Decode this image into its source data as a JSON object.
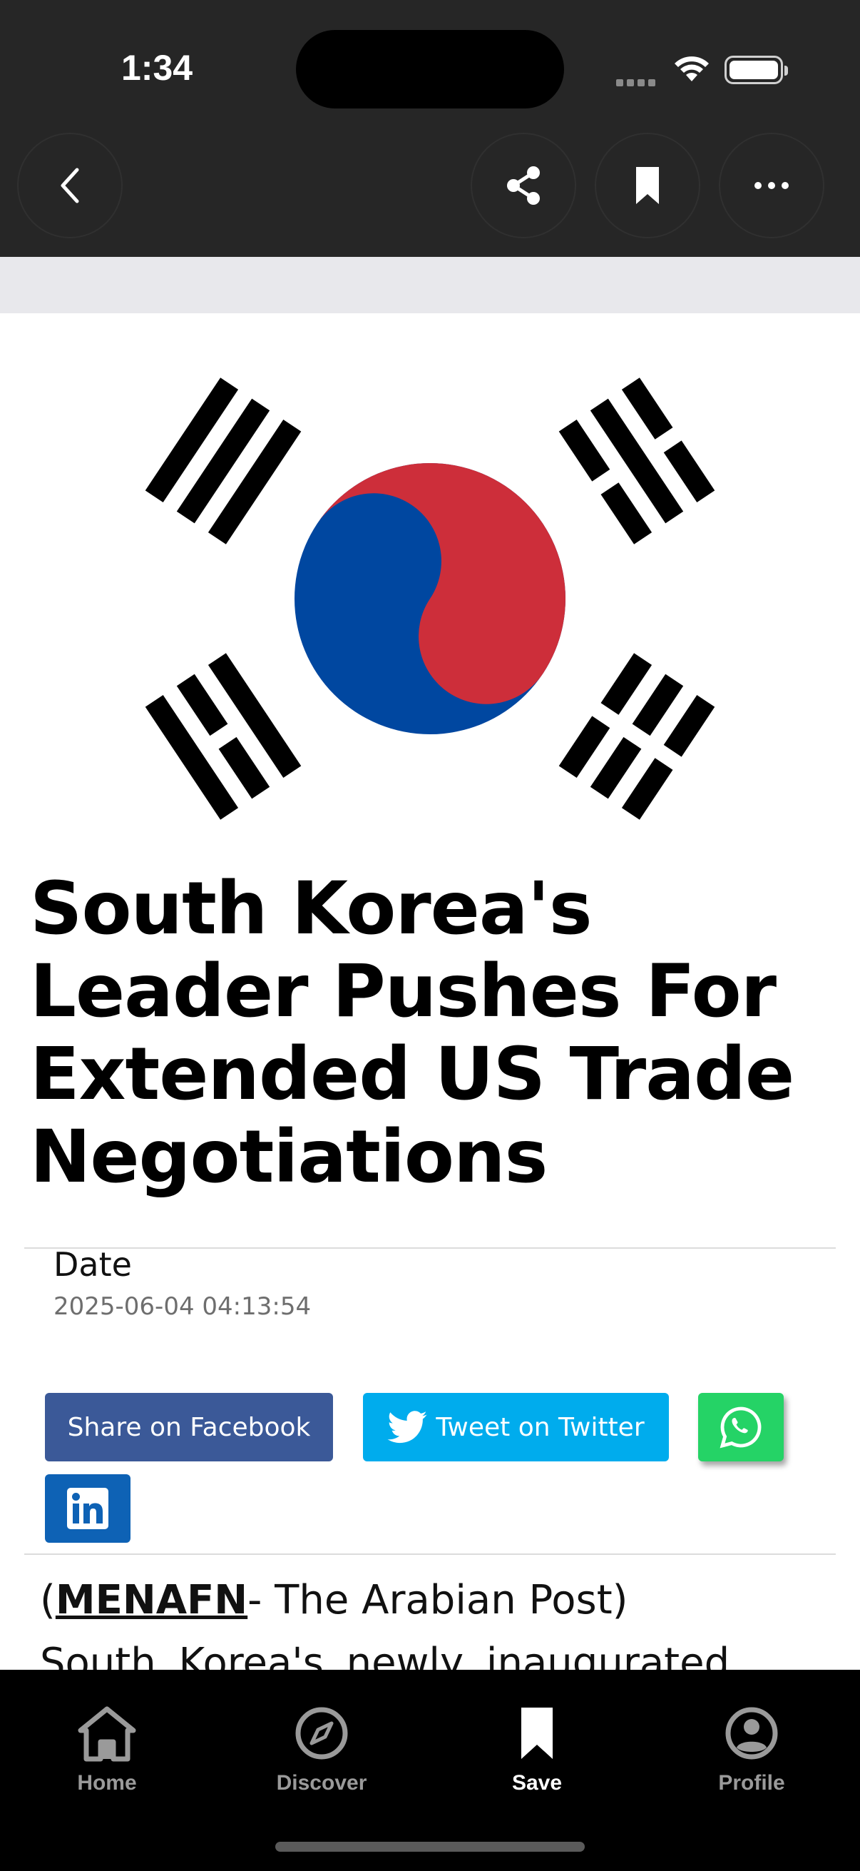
{
  "status_bar": {
    "time": "1:34"
  },
  "toolbar": {
    "back_icon": "chevron-left-icon",
    "share_icon": "share-icon",
    "bookmark_icon": "bookmark-icon",
    "more_icon": "ellipsis-icon"
  },
  "article": {
    "hero_image": "south-korea-flag",
    "title": "South Korea's Leader Pushes For Extended US Trade Negotiations",
    "date_label": "Date",
    "date_value": "2025-06-04 04:13:54",
    "share": {
      "facebook_label": "Share on Facebook",
      "twitter_label": "Tweet on Twitter",
      "whatsapp_icon": "whatsapp-icon",
      "linkedin_icon": "linkedin-icon"
    },
    "source_open": "(",
    "source_link": "MENAFN",
    "source_rest": "- The Arabian Post)",
    "body_start": "South Korea's newly inaugurated"
  },
  "tabbar": {
    "items": [
      {
        "label": "Home",
        "icon": "home-icon",
        "active": false
      },
      {
        "label": "Discover",
        "icon": "compass-icon",
        "active": false
      },
      {
        "label": "Save",
        "icon": "bookmark-icon",
        "active": true
      },
      {
        "label": "Profile",
        "icon": "profile-icon",
        "active": false
      }
    ]
  },
  "colors": {
    "header_bg": "#262626",
    "facebook": "#3b5998",
    "twitter": "#00aced",
    "whatsapp": "#25d366",
    "linkedin": "#0e62b5",
    "flag_red": "#CD2E3A",
    "flag_blue": "#0047A0"
  }
}
